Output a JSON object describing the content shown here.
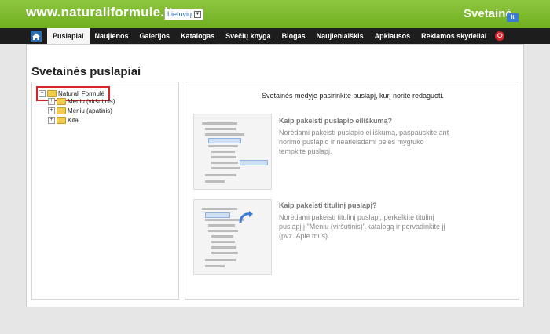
{
  "header": {
    "site_url": "www.naturaliformule.lt",
    "language": "Lietuvių",
    "brand": "Svetainė",
    "brand_badge": "lt"
  },
  "nav": {
    "items": [
      {
        "label": "Puslapiai",
        "active": true
      },
      {
        "label": "Naujienos"
      },
      {
        "label": "Galerijos"
      },
      {
        "label": "Katalogas"
      },
      {
        "label": "Svečių knyga"
      },
      {
        "label": "Blogas"
      },
      {
        "label": "Naujienlaiškis"
      },
      {
        "label": "Apklausos"
      },
      {
        "label": "Reklamos skydeliai"
      }
    ]
  },
  "page": {
    "title": "Svetainės puslapiai"
  },
  "tree": {
    "root": "Naturali Formulė",
    "children": [
      "Meniu (viršutinis)",
      "Meniu (apatinis)",
      "Kita"
    ]
  },
  "content": {
    "intro": "Svetainės medyje pasirinkite puslapį, kurį norite redaguoti.",
    "help": [
      {
        "title": "Kaip pakeisti puslapio eiliškumą?",
        "text": "Norėdami pakeisti puslapio eiliškumą, paspauskite ant norimo puslapio ir neatleisdami pelės mygtuko tempkite puslapį."
      },
      {
        "title": "Kaip pakeisti titulinį puslapį?",
        "text": "Norėdami pakeisti titulinį puslapį, perkelkite titulinį puslapį į \"Meniu (viršutinis)\" katalogą ir pervadinkite jį (pvz. Apie mus)."
      }
    ]
  },
  "colors": {
    "header_green": "#7ab82a",
    "nav_bg": "#1d1d1d",
    "highlight_red": "#d8232a"
  }
}
